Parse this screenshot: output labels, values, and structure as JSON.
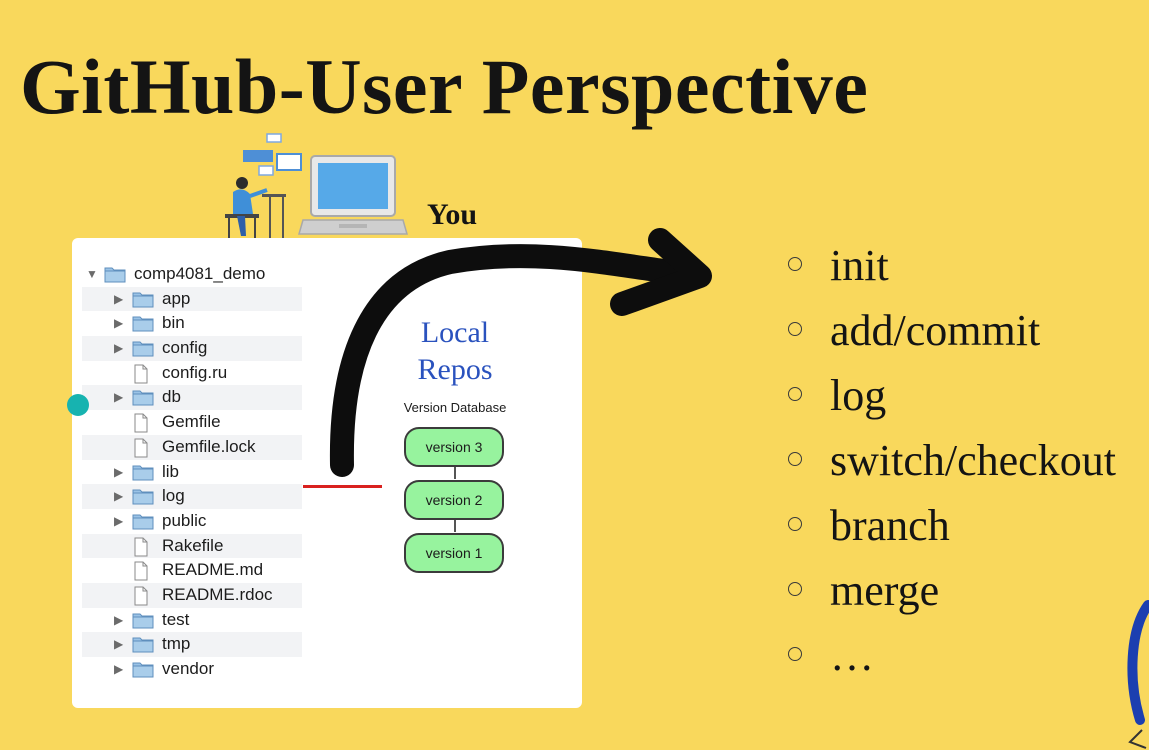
{
  "slide": {
    "title": "GitHub-User Perspective",
    "you_label": "You"
  },
  "file_tree": {
    "root": "comp4081_demo",
    "items": [
      {
        "name": "app",
        "type": "folder"
      },
      {
        "name": "bin",
        "type": "folder"
      },
      {
        "name": "config",
        "type": "folder"
      },
      {
        "name": "config.ru",
        "type": "file"
      },
      {
        "name": "db",
        "type": "folder"
      },
      {
        "name": "Gemfile",
        "type": "file"
      },
      {
        "name": "Gemfile.lock",
        "type": "file"
      },
      {
        "name": "lib",
        "type": "folder"
      },
      {
        "name": "log",
        "type": "folder"
      },
      {
        "name": "public",
        "type": "folder"
      },
      {
        "name": "Rakefile",
        "type": "file"
      },
      {
        "name": "README.md",
        "type": "file"
      },
      {
        "name": "README.rdoc",
        "type": "file"
      },
      {
        "name": "test",
        "type": "folder"
      },
      {
        "name": "tmp",
        "type": "folder"
      },
      {
        "name": "vendor",
        "type": "folder"
      }
    ]
  },
  "local_repos": {
    "title_line1": "Local",
    "title_line2": "Repos",
    "db_label": "Version Database",
    "versions": [
      "version 3",
      "version 2",
      "version 1"
    ]
  },
  "commands": [
    "init",
    "add/commit",
    "log",
    "switch/checkout",
    "branch",
    "merge",
    "…"
  ],
  "colors": {
    "background": "#f9d85c",
    "local_repos_text": "#2a52be",
    "version_fill": "#97f39e",
    "connector": "#d9211f",
    "pointer_dot": "#17b3b0"
  }
}
